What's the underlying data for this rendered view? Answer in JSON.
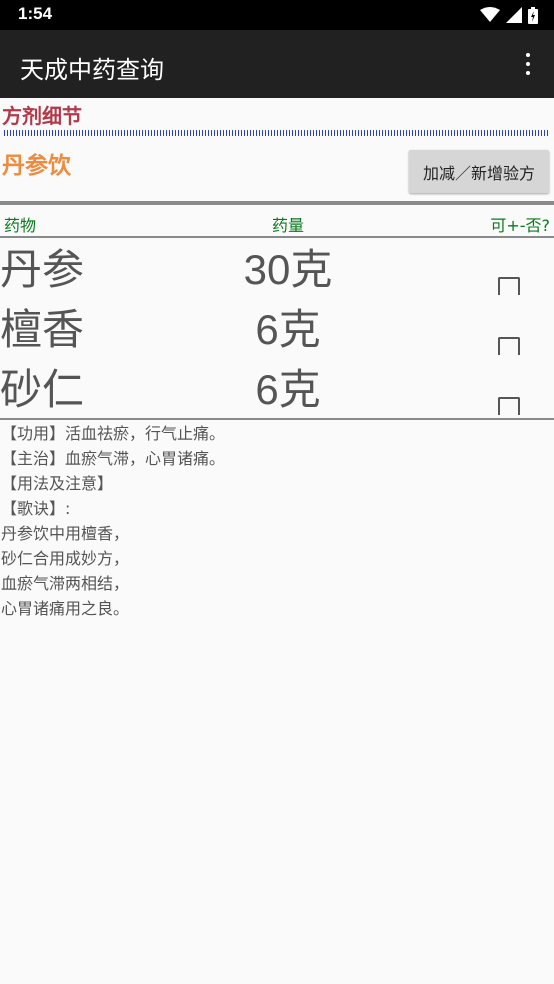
{
  "status_bar": {
    "time": "1:54"
  },
  "app_bar": {
    "title": "天成中药查询"
  },
  "section": {
    "title": "方剂细节"
  },
  "formula": {
    "name": "丹参饮",
    "modify_button_label": "加减／新增验方"
  },
  "table": {
    "headers": {
      "name": "药物",
      "dose": "药量",
      "adjustable": "可+-否?"
    },
    "rows": [
      {
        "name": "丹参",
        "dose": "30克",
        "adjustable": false
      },
      {
        "name": "檀香",
        "dose": "6克",
        "adjustable": false
      },
      {
        "name": "砂仁",
        "dose": "6克",
        "adjustable": false
      }
    ]
  },
  "details": {
    "lines": [
      "【功用】活血祛瘀，行气止痛。",
      "【主治】血瘀气滞，心胃诸痛。",
      "【用法及注意】",
      "【歌诀】:",
      "丹参饮中用檀香，",
      "砂仁合用成妙方，",
      "血瘀气滞两相结，",
      "心胃诸痛用之良。"
    ]
  },
  "icons": {
    "wifi": "wifi-icon",
    "signal": "signal-icon",
    "battery": "battery-icon",
    "overflow": "more-vertical-icon"
  },
  "colors": {
    "section_title": "#b3394a",
    "formula_name": "#f08a3c",
    "table_header": "#0a7a1e",
    "divider_dots": "#2b3fbf"
  }
}
